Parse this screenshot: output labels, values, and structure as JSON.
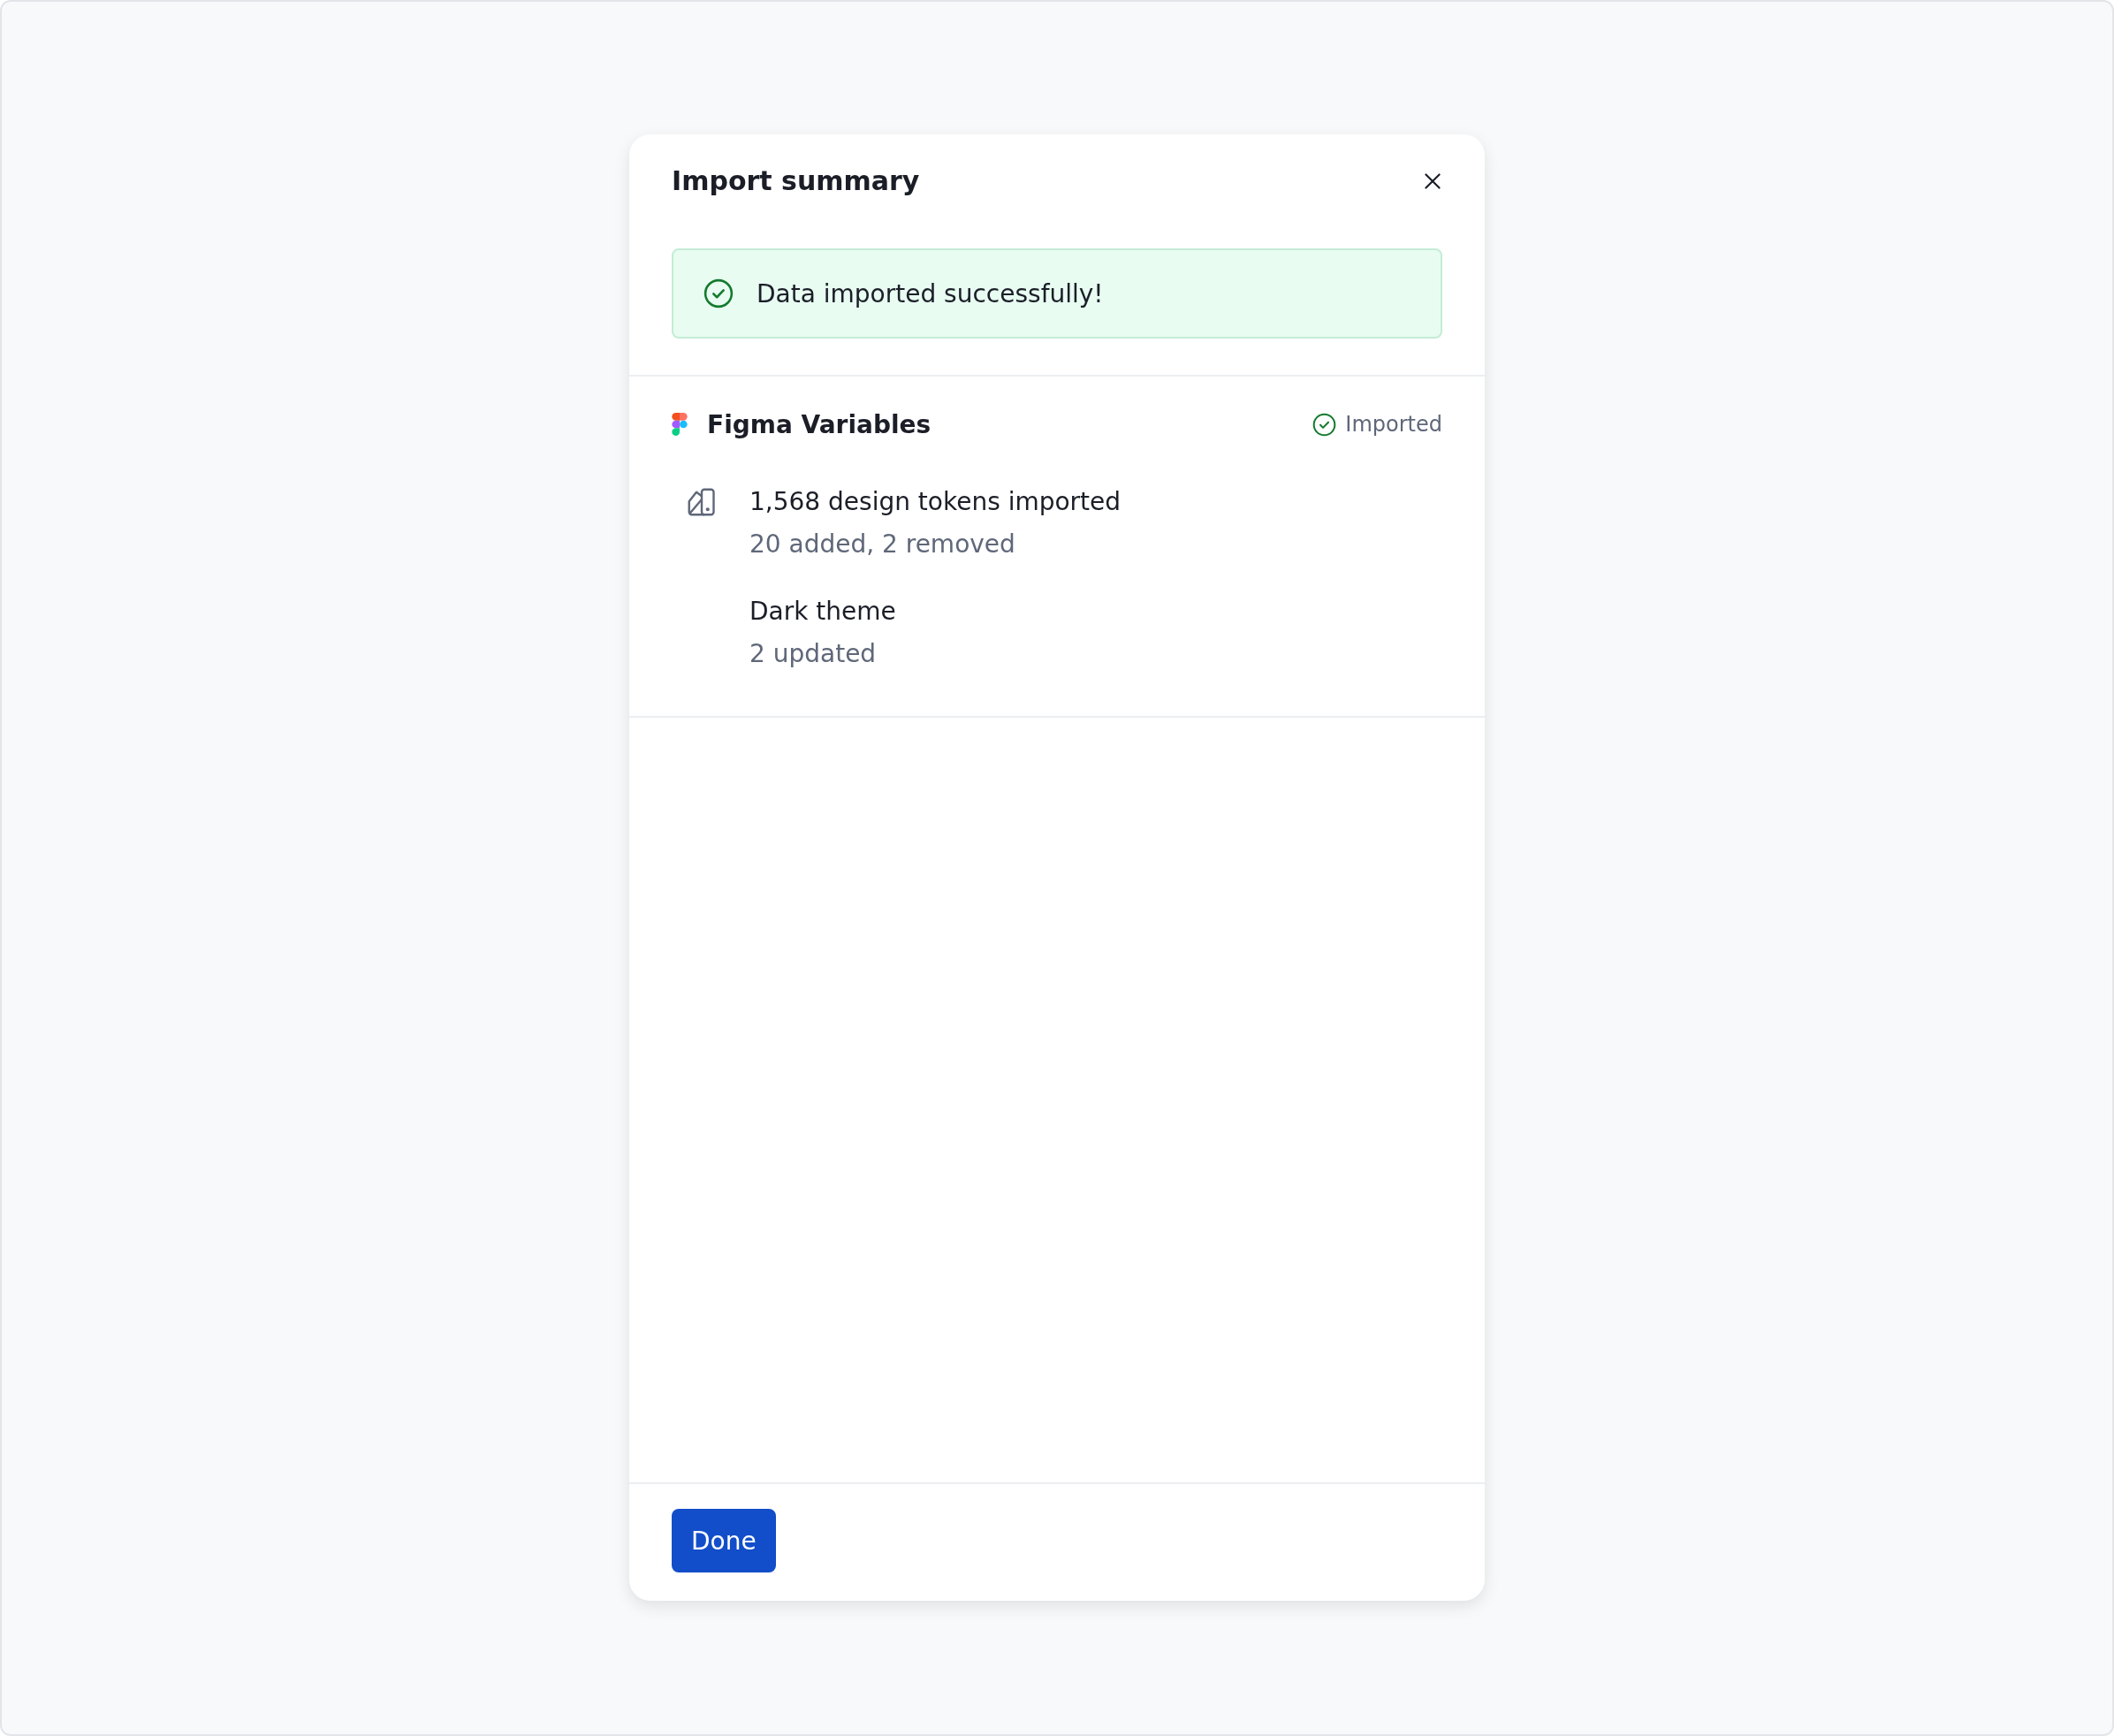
{
  "dialog": {
    "title": "Import summary",
    "alert": {
      "kind": "success",
      "text": "Data imported successfully!"
    },
    "sources": [
      {
        "name": "Figma Variables",
        "status": {
          "kind": "success",
          "label": "Imported"
        },
        "groups": [
          {
            "kind": "tokens",
            "title": "1,568 design tokens imported",
            "detail": "20 added, 2 removed"
          },
          {
            "kind": "mode",
            "title": "Dark theme",
            "detail": "2 updated"
          }
        ]
      }
    ],
    "footer": {
      "primary_button": "Done"
    }
  }
}
